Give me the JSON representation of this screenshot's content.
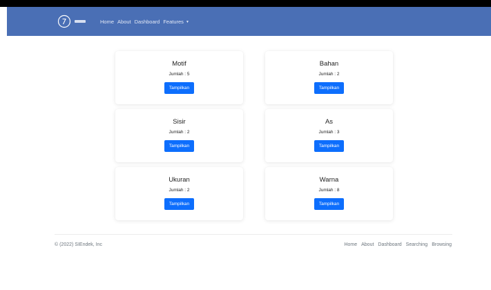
{
  "navbar": {
    "logo_icon": "circle-slash-logo-icon",
    "links": [
      {
        "label": "Home"
      },
      {
        "label": "About"
      },
      {
        "label": "Dashboard"
      },
      {
        "label": "Features"
      }
    ],
    "dropdown_icon": "caret-down-icon"
  },
  "cards": [
    {
      "title": "Motif",
      "count": "Jumlah : 5",
      "button": "Tampilkan"
    },
    {
      "title": "Bahan",
      "count": "Jumlah : 2",
      "button": "Tampilkan"
    },
    {
      "title": "Sisir",
      "count": "Jumlah : 2",
      "button": "Tampilkan"
    },
    {
      "title": "As",
      "count": "Jumlah : 3",
      "button": "Tampilkan"
    },
    {
      "title": "Ukuran",
      "count": "Jumlah : 2",
      "button": "Tampilkan"
    },
    {
      "title": "Warna",
      "count": "Jumlah : 8",
      "button": "Tampilkan"
    }
  ],
  "footer": {
    "copyright": "© (2022) SIEndek, Inc",
    "links": [
      {
        "label": "Home"
      },
      {
        "label": "About"
      },
      {
        "label": "Dashboard"
      },
      {
        "label": "Searching"
      },
      {
        "label": "Browsing"
      }
    ]
  },
  "colors": {
    "navbar": "#4a6fb5",
    "button": "#0d6efd",
    "footer_text": "#6c757d"
  }
}
